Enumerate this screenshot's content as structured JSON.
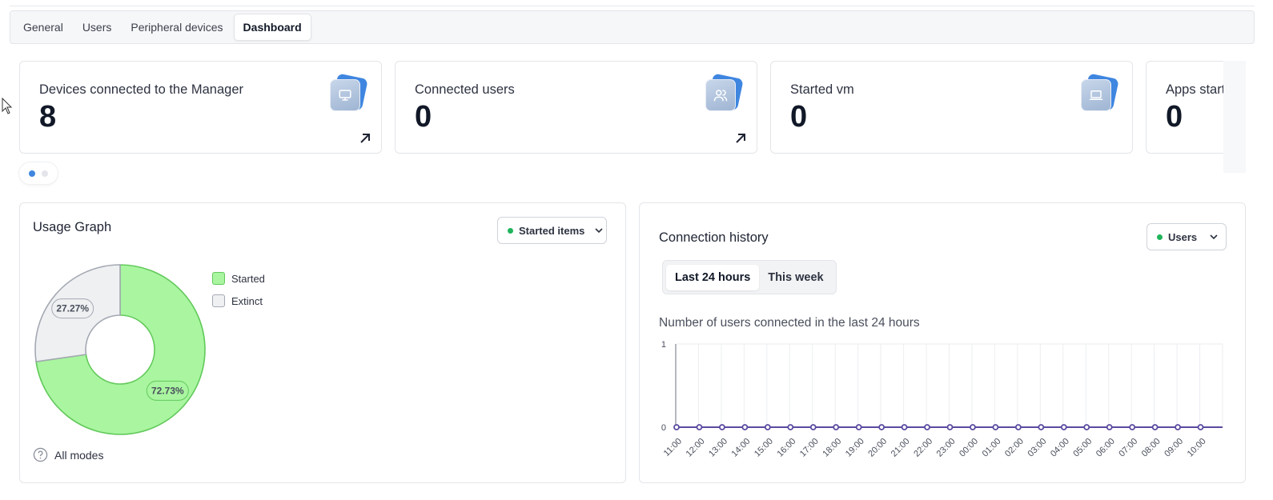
{
  "tabs": [
    {
      "label": "General",
      "active": false
    },
    {
      "label": "Users",
      "active": false
    },
    {
      "label": "Peripheral devices",
      "active": false
    },
    {
      "label": "Dashboard",
      "active": true
    }
  ],
  "cards": [
    {
      "title": "Devices connected to the Manager",
      "value": "8",
      "icon": "monitor-icon",
      "link": true
    },
    {
      "title": "Connected users",
      "value": "0",
      "icon": "users-icon",
      "link": true
    },
    {
      "title": "Started vm",
      "value": "0",
      "icon": "laptop-icon",
      "link": false
    },
    {
      "title": "Apps started",
      "value": "0",
      "icon": "app-icon",
      "link": false
    }
  ],
  "pager": {
    "pages": 2,
    "active": 0
  },
  "usage": {
    "title": "Usage Graph",
    "filter_label": "Started items",
    "footnote": "All modes",
    "chart_data": {
      "type": "pie",
      "donut": true,
      "categories": [
        "Started",
        "Extinct"
      ],
      "values": [
        72.73,
        27.27
      ],
      "labels": [
        "72.73%",
        "27.27%"
      ],
      "colors": [
        "#a9f5a0",
        "#eff0f2"
      ],
      "strokes": [
        "#62c95a",
        "#a4a9b3"
      ]
    }
  },
  "history": {
    "title": "Connection history",
    "filter_label": "Users",
    "range_options": [
      {
        "label": "Last 24 hours",
        "active": true
      },
      {
        "label": "This week",
        "active": false
      }
    ],
    "chart_title": "Number of users connected in the last 24 hours",
    "chart_data": {
      "type": "line",
      "x": [
        "11:00",
        "12:00",
        "13:00",
        "14:00",
        "15:00",
        "16:00",
        "17:00",
        "18:00",
        "19:00",
        "20:00",
        "21:00",
        "22:00",
        "23:00",
        "00:00",
        "01:00",
        "02:00",
        "03:00",
        "04:00",
        "05:00",
        "06:00",
        "07:00",
        "08:00",
        "09:00",
        "10:00"
      ],
      "series": [
        {
          "values": [
            0,
            0,
            0,
            0,
            0,
            0,
            0,
            0,
            0,
            0,
            0,
            0,
            0,
            0,
            0,
            0,
            0,
            0,
            0,
            0,
            0,
            0,
            0,
            0
          ]
        }
      ],
      "yticks": [
        "0",
        "1"
      ],
      "ylim": [
        0,
        1
      ],
      "grid": true,
      "color": "#5b4aa0"
    }
  },
  "colors": {
    "accent": "#3f86e0",
    "success": "#1fb45b"
  }
}
